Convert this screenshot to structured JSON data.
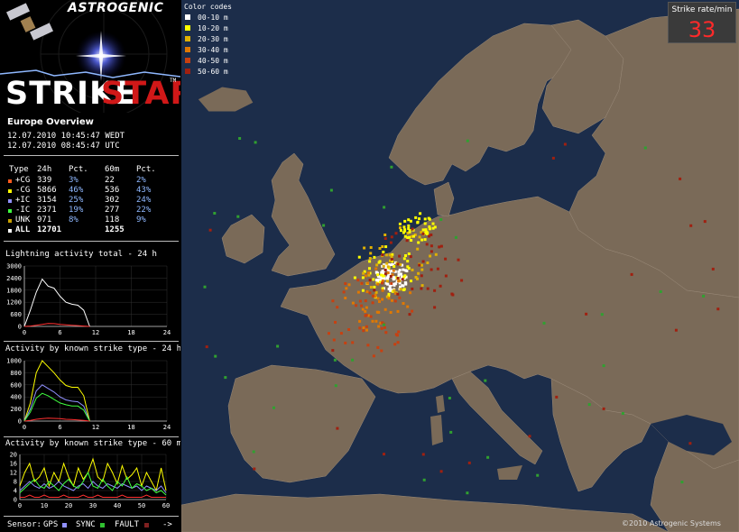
{
  "header": {
    "brand": "ASTROGENIC",
    "logo_part1": "STRIKE",
    "logo_part2": "STAR",
    "tm": "TM"
  },
  "overview": {
    "title": "Europe Overview",
    "local_time": "12.07.2010 10:45:47 WEDT",
    "utc_time": "12.07.2010 08:45:47 UTC"
  },
  "stats": {
    "headers": [
      "Type",
      "24h",
      "Pct.",
      "60m",
      "Pct."
    ],
    "rows": [
      {
        "type": "+CG",
        "h24": "339",
        "pct24": "3%",
        "m60": "22",
        "pct60": "2%",
        "color": "#ff5a1e"
      },
      {
        "type": "-CG",
        "h24": "5866",
        "pct24": "46%",
        "m60": "536",
        "pct60": "43%",
        "color": "#ffff00"
      },
      {
        "type": "+IC",
        "h24": "3154",
        "pct24": "25%",
        "m60": "302",
        "pct60": "24%",
        "color": "#9090ff"
      },
      {
        "type": "-IC",
        "h24": "2371",
        "pct24": "19%",
        "m60": "277",
        "pct60": "22%",
        "color": "#40ff40"
      },
      {
        "type": "UNK",
        "h24": "971",
        "pct24": "8%",
        "m60": "118",
        "pct60": "9%",
        "color": "#c8a000"
      },
      {
        "type": "ALL",
        "h24": "12701",
        "pct24": "",
        "m60": "1255",
        "pct60": "",
        "color": "#ffffff"
      }
    ]
  },
  "charts": {
    "total_title": "Lightning activity total - 24 h",
    "type24_title": "Activity by known strike type - 24 h",
    "type60_title": "Activity by known strike type - 60 min"
  },
  "chart_data": [
    {
      "type": "line",
      "title": "Lightning activity total - 24 h",
      "x_ticks": [
        "0",
        "6",
        "12",
        "18",
        "24"
      ],
      "y_ticks": [
        "0",
        "600",
        "1200",
        "1800",
        "2400",
        "3000"
      ],
      "ylim": [
        0,
        3000
      ],
      "x": [
        0,
        1,
        2,
        3,
        4,
        5,
        6,
        7,
        8,
        9,
        10,
        11
      ],
      "series": [
        {
          "color": "#ffffff",
          "values": [
            0,
            800,
            1700,
            2350,
            2000,
            1900,
            1500,
            1200,
            1100,
            1050,
            800,
            0
          ]
        },
        {
          "color": "#ff3030",
          "values": [
            0,
            20,
            60,
            100,
            150,
            140,
            100,
            80,
            60,
            40,
            20,
            0
          ]
        }
      ]
    },
    {
      "type": "line",
      "title": "Activity by known strike type - 24 h",
      "x_ticks": [
        "0",
        "6",
        "12",
        "18",
        "24"
      ],
      "y_ticks": [
        "0",
        "200",
        "400",
        "600",
        "800",
        "1000"
      ],
      "ylim": [
        0,
        1000
      ],
      "x": [
        0,
        1,
        2,
        3,
        4,
        5,
        6,
        7,
        8,
        9,
        10,
        11
      ],
      "series": [
        {
          "color": "#ffff00",
          "values": [
            0,
            300,
            800,
            1000,
            900,
            800,
            680,
            590,
            560,
            560,
            420,
            0
          ]
        },
        {
          "color": "#9090ff",
          "values": [
            0,
            200,
            500,
            600,
            540,
            480,
            400,
            350,
            330,
            320,
            250,
            0
          ]
        },
        {
          "color": "#40ff40",
          "values": [
            0,
            150,
            380,
            460,
            420,
            360,
            300,
            270,
            250,
            250,
            180,
            0
          ]
        },
        {
          "color": "#ff3030",
          "values": [
            0,
            10,
            30,
            40,
            50,
            45,
            40,
            30,
            25,
            20,
            10,
            0
          ]
        }
      ]
    },
    {
      "type": "line",
      "title": "Activity by known strike type - 60 min",
      "x_ticks": [
        "0",
        "10",
        "20",
        "30",
        "40",
        "50",
        "60"
      ],
      "y_ticks": [
        "0",
        "4",
        "8",
        "12",
        "16",
        "20"
      ],
      "ylim": [
        0,
        20
      ],
      "x": [
        0,
        2,
        4,
        6,
        8,
        10,
        12,
        14,
        16,
        18,
        20,
        22,
        24,
        26,
        28,
        30,
        32,
        34,
        36,
        38,
        40,
        42,
        44,
        46,
        48,
        50,
        52,
        54,
        56,
        58,
        60
      ],
      "series": [
        {
          "color": "#ffff00",
          "values": [
            6,
            12,
            16,
            8,
            10,
            14,
            6,
            12,
            8,
            16,
            10,
            6,
            14,
            9,
            12,
            18,
            10,
            8,
            16,
            12,
            7,
            15,
            9,
            11,
            14,
            6,
            12,
            8,
            4,
            14,
            4
          ]
        },
        {
          "color": "#9090ff",
          "values": [
            4,
            6,
            8,
            6,
            5,
            7,
            5,
            6,
            8,
            6,
            5,
            4,
            6,
            7,
            5,
            8,
            6,
            5,
            7,
            6,
            5,
            7,
            6,
            5,
            6,
            4,
            6,
            5,
            4,
            6,
            3
          ]
        },
        {
          "color": "#40ff40",
          "values": [
            3,
            5,
            7,
            9,
            6,
            5,
            8,
            6,
            4,
            7,
            9,
            6,
            5,
            8,
            12,
            6,
            5,
            9,
            6,
            4,
            8,
            6,
            10,
            5,
            7,
            6,
            4,
            5,
            3,
            4,
            2
          ]
        },
        {
          "color": "#ff3030",
          "values": [
            1,
            1,
            2,
            1,
            1,
            2,
            1,
            1,
            1,
            2,
            1,
            1,
            1,
            2,
            1,
            1,
            2,
            1,
            1,
            1,
            1,
            2,
            1,
            1,
            1,
            1,
            2,
            1,
            1,
            1,
            1
          ]
        }
      ]
    }
  ],
  "sensor": {
    "label": "Sensor:",
    "items": [
      {
        "name": "GPS",
        "color": "#9090ff"
      },
      {
        "name": "SYNC",
        "color": "#30c030"
      },
      {
        "name": "FAULT",
        "color": "#802020"
      }
    ],
    "arrow": "->"
  },
  "legend": {
    "title": "Color codes",
    "items": [
      {
        "label": "00-10 m",
        "color": "#ffffff"
      },
      {
        "label": "10-20 m",
        "color": "#ffff00"
      },
      {
        "label": "20-30 m",
        "color": "#e0b000"
      },
      {
        "label": "30-40 m",
        "color": "#e07800"
      },
      {
        "label": "40-50 m",
        "color": "#c84010"
      },
      {
        "label": "50-60 m",
        "color": "#a02010"
      }
    ]
  },
  "strike_rate": {
    "label": "Strike rate/min",
    "value": "33"
  },
  "copyright": "©2010 Astrogenic Systems",
  "colors": {
    "sea": "#1c2d4a",
    "land": "#7a6a58",
    "border": "#9a8a78",
    "accent_red": "#d01818"
  }
}
